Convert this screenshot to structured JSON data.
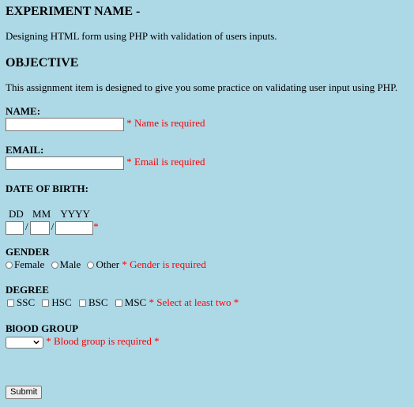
{
  "header": {
    "experiment_heading": "EXPERIMENT NAME -",
    "experiment_text": "Designing HTML form using PHP with validation of users inputs.",
    "objective_heading": "OBJECTIVE",
    "objective_text": "This assignment item is designed to give you some practice on validating user input using PHP."
  },
  "form": {
    "name": {
      "label": "NAME:",
      "value": "",
      "error": "* Name is required"
    },
    "email": {
      "label": "EMAIL:",
      "value": "",
      "error": "* Email is required"
    },
    "dob": {
      "label": "DATE OF BIRTH:",
      "dd_label": "DD",
      "mm_label": "MM",
      "yyyy_label": "YYYY",
      "separator": "/",
      "error": "*"
    },
    "gender": {
      "label": "GENDER",
      "options": [
        "Female",
        "Male",
        "Other"
      ],
      "error": "* Gender is required"
    },
    "degree": {
      "label": "DEGREE",
      "options": [
        "SSC",
        "HSC",
        "BSC",
        "MSC"
      ],
      "error": "* Select at least two *"
    },
    "blood_group": {
      "label": "BlOOD GROUP",
      "selected": "",
      "error": "* Blood group is required *"
    },
    "submit_label": "Submit"
  }
}
